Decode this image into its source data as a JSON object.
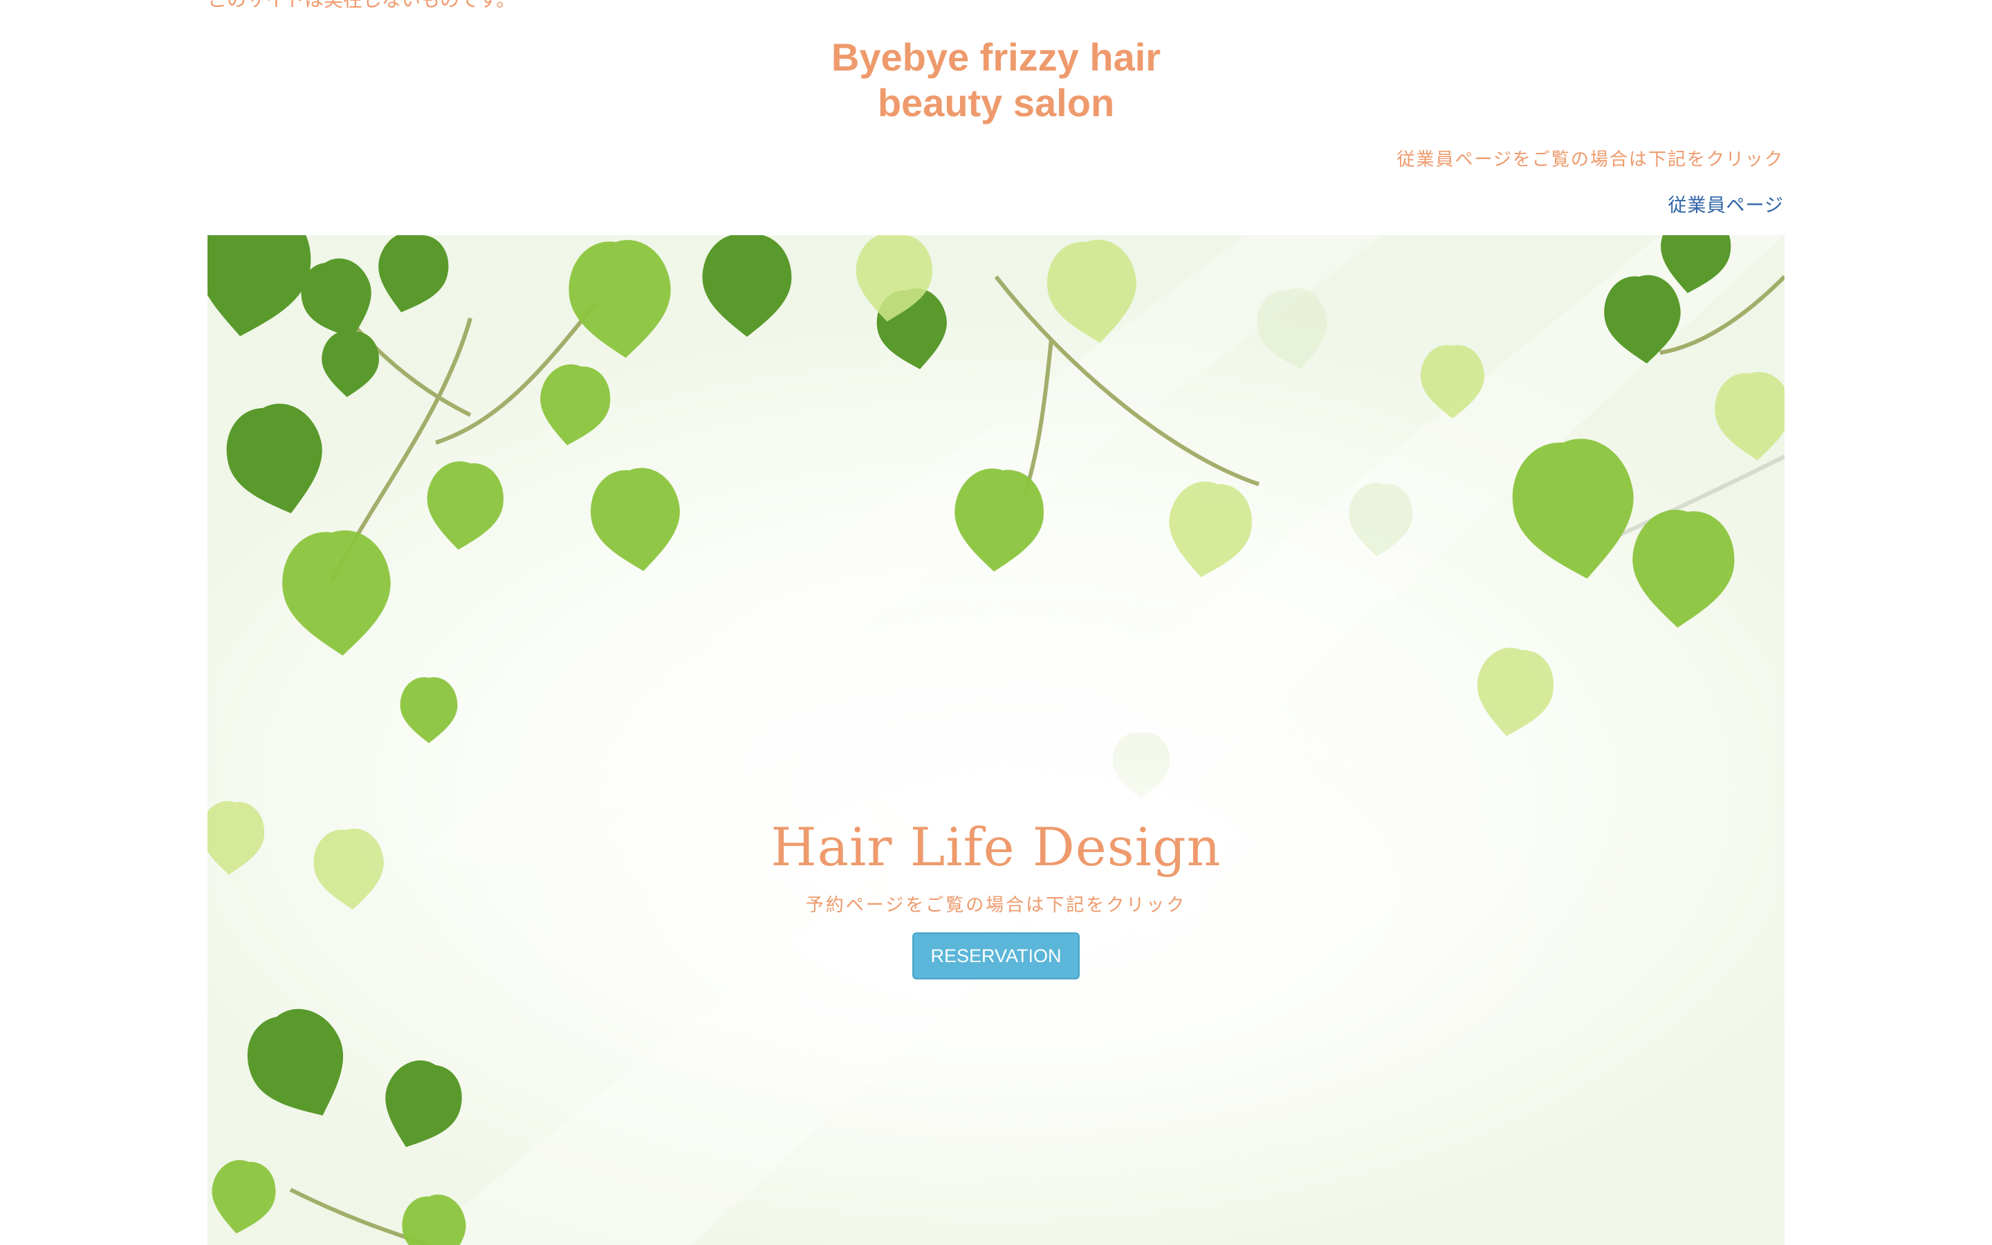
{
  "top_notice": "このサイトは実在しないものです。",
  "header": {
    "title_line1": "Byebye frizzy hair",
    "title_line2": "beauty salon",
    "staff_note": "従業員ページをご覧の場合は下記をクリック",
    "staff_link": "従業員ページ"
  },
  "hero": {
    "title": "Hair Life Design",
    "subtitle": "予約ページをご覧の場合は下記をクリック",
    "button_label": "RESERVATION"
  },
  "colors": {
    "accent": "#ee9a6c",
    "link": "#2f64a6",
    "button": "#5bb6d9",
    "leaf_dark": "#5a9a2c",
    "leaf_mid": "#8cc53e",
    "leaf_light": "#cfe78a"
  }
}
